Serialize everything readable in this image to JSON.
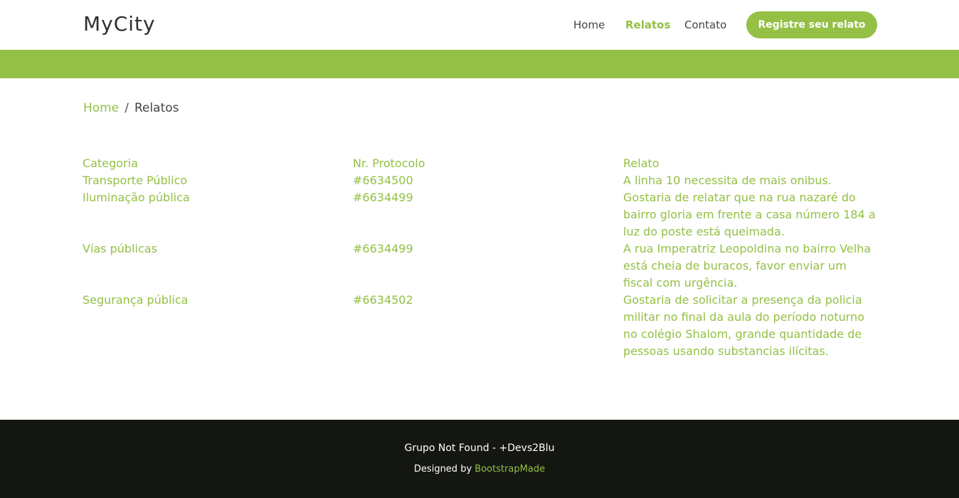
{
  "brand": {
    "name": "MyCity"
  },
  "nav": {
    "items": [
      {
        "label": "Home"
      },
      {
        "label": "Relatos"
      },
      {
        "label": "Contato"
      }
    ],
    "cta_label": "Registre seu relato"
  },
  "colors": {
    "accent": "#94c045",
    "footer_bg": "#141612"
  },
  "breadcrumb": {
    "home": "Home",
    "separator": "/",
    "current": "Relatos"
  },
  "table": {
    "headers": [
      "Categoria",
      "Nr. Protocolo",
      "Relato"
    ],
    "rows": [
      {
        "categoria": "Transporte Público",
        "protocolo": "#6634500",
        "relato": "A linha 10 necessita de mais onibus."
      },
      {
        "categoria": "Iluminação pública",
        "protocolo": "#6634499",
        "relato": "Gostaria de relatar que na rua nazaré do bairro gloria em frente a casa número 184 a luz do poste está queimada."
      },
      {
        "categoria": "Vías públicas",
        "protocolo": "#6634499",
        "relato": "A rua Imperatriz Leopoldina no bairro Velha está cheia de buracos, favor enviar um fiscal com urgência."
      },
      {
        "categoria": "Segurança pública",
        "protocolo": "#6634502",
        "relato": "Gostaria de solicitar a presença da policia militar no final da aula do período noturno no colégio Shalom, grande quantidade de pessoas usando substancias ilícitas."
      }
    ]
  },
  "footer": {
    "copyright": "Grupo Not Found - +Devs2Blu",
    "designed_by": "Designed by",
    "designer": "BootstrapMade"
  }
}
